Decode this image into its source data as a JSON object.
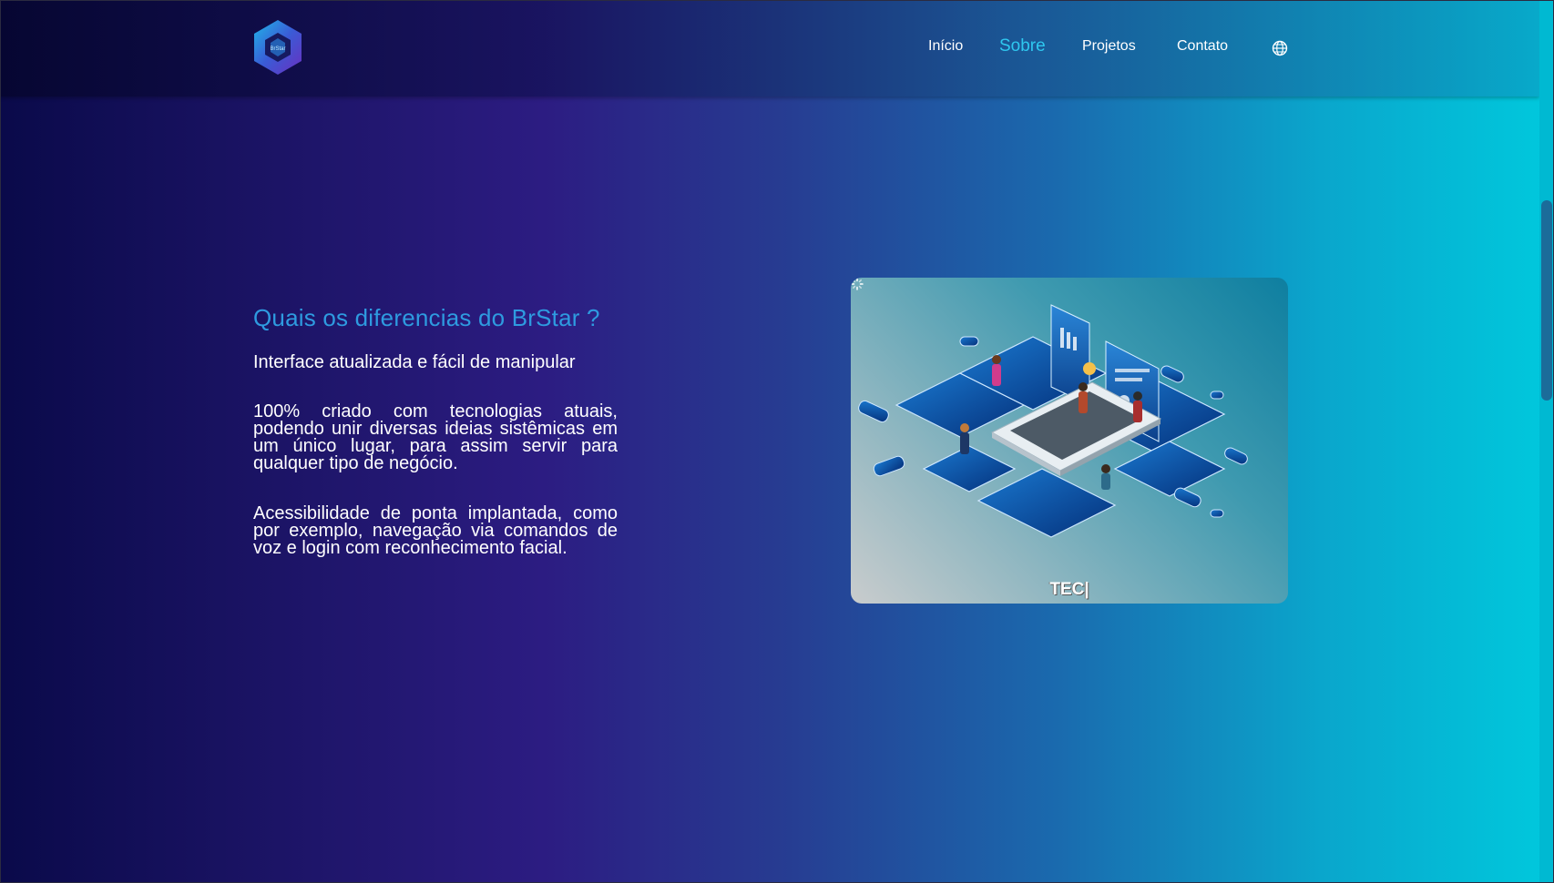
{
  "header": {
    "logo_icon": "hexagon-logo-icon",
    "logo_text": "BrStar",
    "nav": [
      {
        "label": "Início",
        "active": false
      },
      {
        "label": "Sobre",
        "active": true
      },
      {
        "label": "Projetos",
        "active": false
      },
      {
        "label": "Contato",
        "active": false
      }
    ],
    "language_icon": "globe-icon"
  },
  "about": {
    "title": "Quais os diferencias do BrStar ?",
    "paragraphs": [
      "Interface atualizada e fácil de manipular",
      "100% criado com tecnologias atuais, podendo unir diversas ideias sistêmicas em um único lugar, para assim servir para qualquer tipo de negócio.",
      "Acessibilidade de ponta implantada, como por exemplo, navegação via comandos de voz e login com reconhecimento facial."
    ]
  },
  "illustration": {
    "caption": "TEC|",
    "loading_icon": "spinner-icon"
  },
  "colors": {
    "accent": "#2ec7ef",
    "title": "#2e9be0",
    "bg_left": "#0a0a4a",
    "bg_right": "#00c9dd"
  }
}
